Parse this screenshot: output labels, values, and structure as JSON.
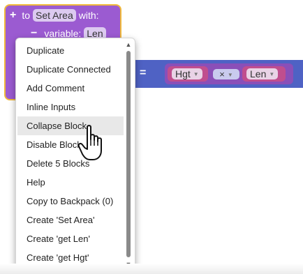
{
  "procedure": {
    "keyword_to": "to",
    "name": "Set Area",
    "keyword_with": "with:",
    "param_keyword": "variable:",
    "param_name": "Len"
  },
  "expression": {
    "equals": "=",
    "left_var": "Hgt",
    "operator": "×",
    "right_var": "Len"
  },
  "context_menu": {
    "items": [
      {
        "label": "Duplicate"
      },
      {
        "label": "Duplicate Connected"
      },
      {
        "label": "Add Comment"
      },
      {
        "label": "Inline Inputs"
      },
      {
        "label": "Collapse Block"
      },
      {
        "label": "Disable Block"
      },
      {
        "label": "Delete 5 Blocks"
      },
      {
        "label": "Help"
      },
      {
        "label": "Copy to Backpack (0)"
      },
      {
        "label": "Create 'Set Area'"
      },
      {
        "label": "Create 'get Len'"
      },
      {
        "label": "Create 'get Hgt'"
      }
    ],
    "hovered_item": "Collapse Block"
  },
  "colors": {
    "procedure_block": "#9b5bd1",
    "selection_outline": "#f0b93a",
    "math_block": "#4f62c4",
    "variable_block": "#c04e8e",
    "menu_hover": "#e8e8e8"
  }
}
